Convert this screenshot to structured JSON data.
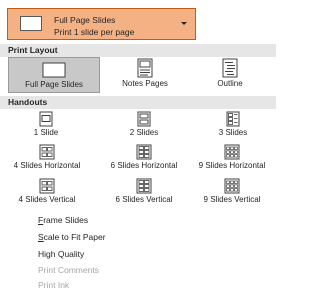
{
  "dropdown": {
    "title": "Full Page Slides",
    "subtitle": "Print 1 slide per page",
    "accent_color": "#f4b183",
    "icon": "chevron-down-icon"
  },
  "print_layout": {
    "header": "Print Layout",
    "items": [
      {
        "label": "Full Page Slides",
        "icon": "full-page-slides-icon",
        "selected": true
      },
      {
        "label": "Notes Pages",
        "icon": "notes-pages-icon",
        "selected": false
      },
      {
        "label": "Outline",
        "icon": "outline-icon",
        "selected": false
      }
    ]
  },
  "handouts": {
    "header": "Handouts",
    "items": [
      {
        "label": "1 Slide",
        "icon": "handout-1-slide-icon"
      },
      {
        "label": "2 Slides",
        "icon": "handout-2-slides-icon"
      },
      {
        "label": "3 Slides",
        "icon": "handout-3-slides-icon"
      },
      {
        "label": "4 Slides Horizontal",
        "icon": "handout-4-horizontal-icon"
      },
      {
        "label": "6 Slides Horizontal",
        "icon": "handout-6-horizontal-icon"
      },
      {
        "label": "9 Slides Horizontal",
        "icon": "handout-9-horizontal-icon"
      },
      {
        "label": "4 Slides Vertical",
        "icon": "handout-4-vertical-icon"
      },
      {
        "label": "6 Slides Vertical",
        "icon": "handout-6-vertical-icon"
      },
      {
        "label": "9 Slides Vertical",
        "icon": "handout-9-vertical-icon"
      }
    ]
  },
  "options": [
    {
      "label": "Frame Slides",
      "access_key": "F",
      "rest": "rame Slides",
      "enabled": true
    },
    {
      "label": "Scale to Fit Paper",
      "access_key": "S",
      "rest": "cale to Fit Paper",
      "enabled": true
    },
    {
      "label": "High Quality",
      "access_key": "",
      "rest": "High Quality",
      "enabled": true
    },
    {
      "label": "Print Comments",
      "access_key": "",
      "rest": "Print Comments",
      "enabled": false
    },
    {
      "label": "Print Ink",
      "access_key": "",
      "rest": "Print Ink",
      "enabled": false
    }
  ]
}
